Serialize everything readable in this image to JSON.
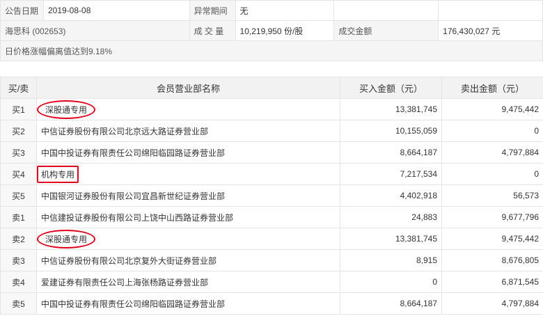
{
  "info": {
    "date_label": "公告日期",
    "date_value": "2019-08-08",
    "period_label": "异常期间",
    "period_value": "无",
    "stock": "海思科 (002653)",
    "volume_label": "成 交 量",
    "volume_value": "10,219,950 份/股",
    "amount_label": "成交金额",
    "amount_value": "176,430,027 元",
    "reason": "日价格涨幅偏离值达到9.18%"
  },
  "table": {
    "headers": [
      "买/卖",
      "会员营业部名称",
      "买入金额（元）",
      "卖出金额（元）"
    ],
    "rows": [
      {
        "side": "买1",
        "name": "深股通专用",
        "buy": "13,381,745",
        "sell": "9,475,442"
      },
      {
        "side": "买2",
        "name": "中信证券股份有限公司北京远大路证券营业部",
        "buy": "10,155,059",
        "sell": "0"
      },
      {
        "side": "买3",
        "name": "中国中投证券有限责任公司绵阳临园路证券营业部",
        "buy": "8,664,187",
        "sell": "4,797,884"
      },
      {
        "side": "买4",
        "name": "机构专用",
        "buy": "7,217,534",
        "sell": "0"
      },
      {
        "side": "买5",
        "name": "中国银河证券股份有限公司宜昌新世纪证券营业部",
        "buy": "4,402,918",
        "sell": "56,573"
      },
      {
        "side": "卖1",
        "name": "中信建投证券股份有限公司上饶中山西路证券营业部",
        "buy": "24,883",
        "sell": "9,677,796"
      },
      {
        "side": "卖2",
        "name": "深股通专用",
        "buy": "13,381,745",
        "sell": "9,475,442"
      },
      {
        "side": "卖3",
        "name": "中信证券股份有限公司北京复外大街证券营业部",
        "buy": "8,915",
        "sell": "8,676,805"
      },
      {
        "side": "卖4",
        "name": "爱建证券有限责任公司上海张杨路证券营业部",
        "buy": "0",
        "sell": "6,871,545"
      },
      {
        "side": "卖5",
        "name": "中国中投证券有限责任公司绵阳临园路证券营业部",
        "buy": "8,664,187",
        "sell": "4,797,884"
      }
    ]
  },
  "highlight_color": "#e0001b"
}
